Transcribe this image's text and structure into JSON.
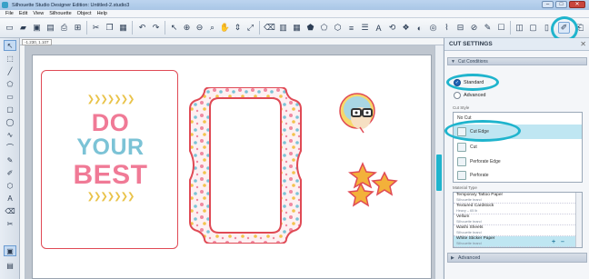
{
  "window": {
    "title": "Silhouette Studio Designer Edition: Untitled-2.studio3",
    "controls": [
      "–",
      "□",
      "✕"
    ]
  },
  "menu": [
    "File",
    "Edit",
    "View",
    "Silhouette",
    "Object",
    "Help"
  ],
  "ruler": {
    "coordinate": "-1.230, 1.107"
  },
  "design": {
    "quote_lines": [
      "DO",
      "YOUR",
      "BEST"
    ],
    "quote_colors": [
      "#f07a96",
      "#7cc3d6",
      "#f07a96"
    ],
    "accent": "#e04a55",
    "chevrons": "❯❯❯❯❯❯❯"
  },
  "panel": {
    "title": "CUT SETTINGS",
    "close": "✕",
    "cut_conditions_label": "Cut Conditions",
    "modes": [
      {
        "label": "Standard",
        "selected": true
      },
      {
        "label": "Advanced",
        "selected": false
      }
    ],
    "cut_style_label": "Cut Style",
    "cut_styles": [
      {
        "label": "No Cut",
        "selected": false
      },
      {
        "label": "Cut Edge",
        "selected": true
      },
      {
        "label": "Cut",
        "selected": false
      },
      {
        "label": "Perforate Edge",
        "selected": false
      },
      {
        "label": "Perforate",
        "selected": false
      }
    ],
    "material_type_label": "Material Type",
    "materials": [
      {
        "name": "Temporary Tattoo Paper",
        "brand": "Silhouette brand"
      },
      {
        "name": "Textured Cardstock",
        "brand": "Heavy – 65 lb"
      },
      {
        "name": "Vellum",
        "brand": "Silhouette brand"
      },
      {
        "name": "Washi Sheets",
        "brand": "Silhouette brand"
      },
      {
        "name": "White Sticker Paper",
        "brand": "Silhouette brand",
        "selected": true
      }
    ],
    "material_buttons": [
      "+",
      "–"
    ],
    "advanced_label": "Advanced"
  },
  "colors": {
    "highlight": "#1fb4cd",
    "selection": "#bfe6f2",
    "title_bar": "#bcd4ef"
  }
}
